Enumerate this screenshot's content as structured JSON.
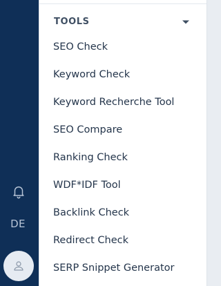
{
  "rail": {
    "bell_icon": "bell-icon",
    "language": "DE",
    "avatar_icon": "user-icon"
  },
  "tools": {
    "title": "TOOLS",
    "caret_icon": "caret-down-icon",
    "items": [
      "SEO Check",
      "Keyword Check",
      "Keyword Recherche Tool",
      "SEO Compare",
      "Ranking Check",
      "WDF*IDF Tool",
      "Backlink Check",
      "Redirect Check",
      "SERP Snippet Generator"
    ]
  },
  "colors": {
    "rail": "#0f2f57",
    "text": "#24354b",
    "background": "#e9edf2"
  }
}
